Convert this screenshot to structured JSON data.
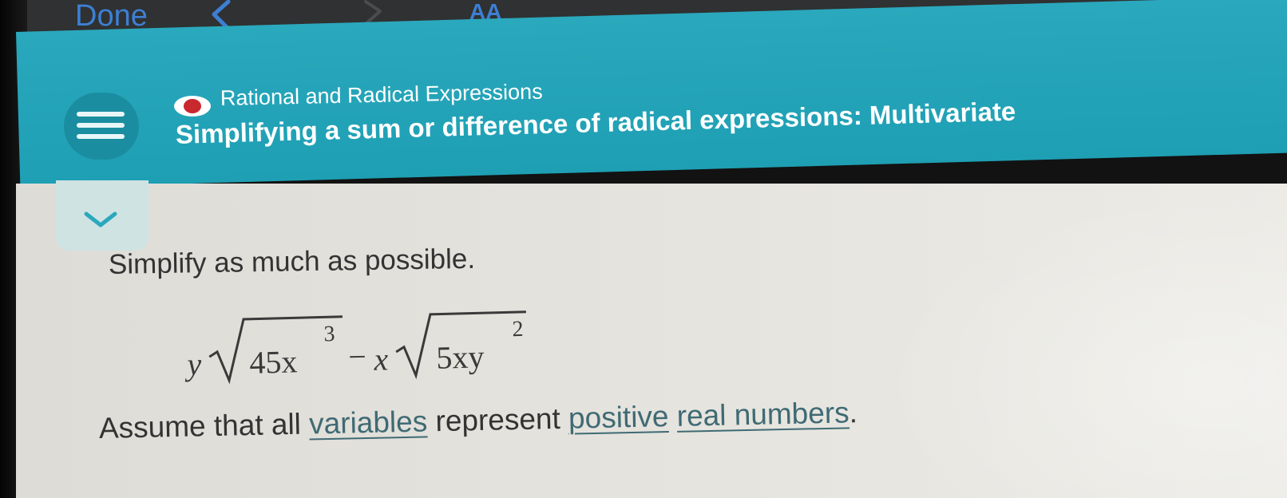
{
  "browser": {
    "done_label": "Done",
    "text_size_label": "AA"
  },
  "header": {
    "topic": "Rational and Radical Expressions",
    "title": "Simplifying a sum or difference of radical expressions: Multivariate"
  },
  "problem": {
    "instruction": "Simplify as much as possible.",
    "expression": {
      "term1_coef": "y",
      "term1_radicand": "45x",
      "term1_exponent": "3",
      "operator": "−",
      "term2_coef": "x",
      "term2_radicand": "5xy",
      "term2_exponent": "2"
    },
    "assume": {
      "prefix": "Assume that all",
      "link1": "variables",
      "middle": "represent",
      "link2": "positive",
      "link3": "real numbers",
      "suffix": "."
    }
  },
  "colors": {
    "header_teal": "#1e9fb3",
    "ios_blue": "#3d7fd3",
    "status_red": "#c9282e",
    "link": "#3f6a74"
  }
}
